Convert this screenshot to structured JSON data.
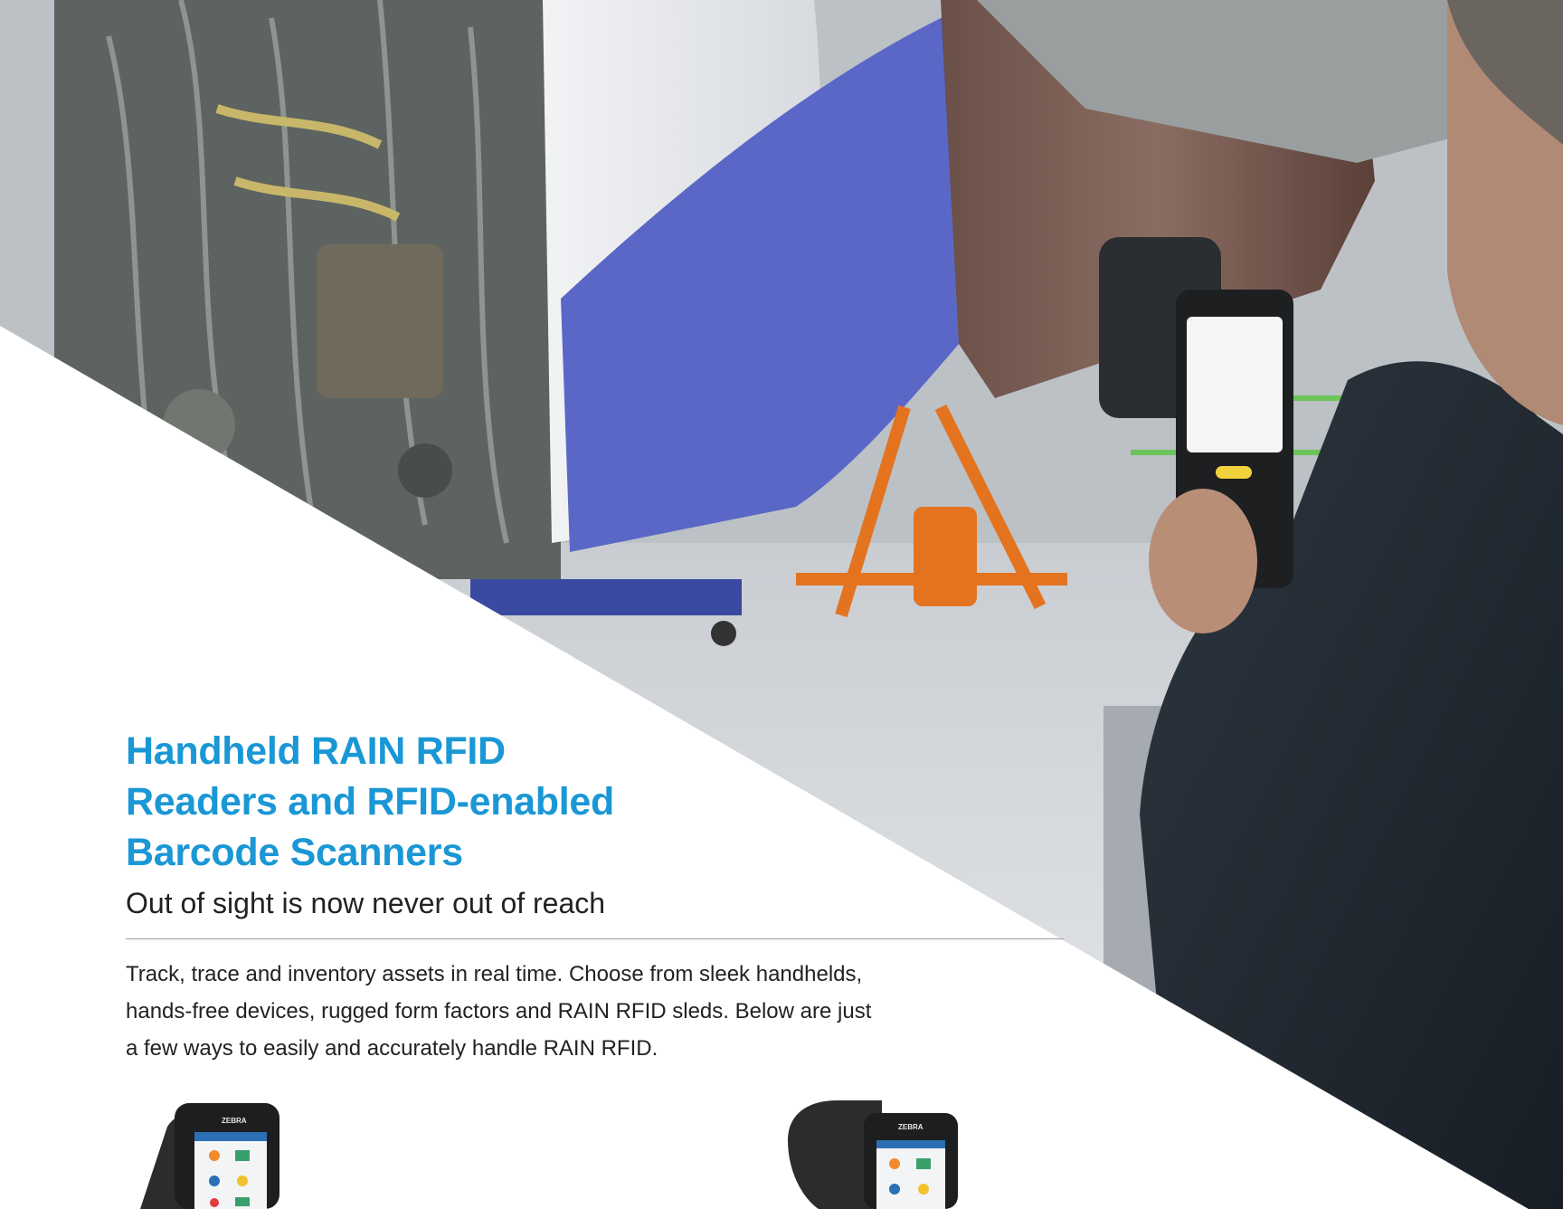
{
  "hero": {
    "title_lines": [
      "Handheld RAIN RFID",
      "Readers and RFID-enabled",
      "Barcode Scanners"
    ],
    "subtitle": "Out of sight is now never out of reach",
    "image_subject": "technician scanning aircraft engine with handheld RFID reader in hangar"
  },
  "intro": {
    "lines": [
      "Track, trace and inventory assets in real time. Choose from sleek handhelds,",
      "hands-free devices, rugged form factors and RAIN RFID sleds. Below are just",
      "a few ways to easily and accurately handle RAIN RFID."
    ]
  },
  "devices": [
    {
      "name": "handheld-rfid-reader-1",
      "brand": "ZEBRA"
    },
    {
      "name": "handheld-rfid-reader-2",
      "brand": "ZEBRA"
    }
  ],
  "colors": {
    "title": "#1a97d5",
    "text": "#222222",
    "rule": "#9a9a9a"
  }
}
